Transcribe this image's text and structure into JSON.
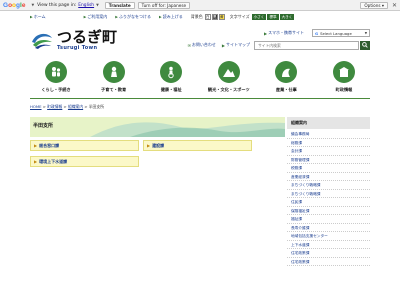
{
  "google_translate_bar": {
    "brand": "Google",
    "prompt": "View this page in:",
    "language": "English",
    "translate_label": "Translate",
    "turn_off_label": "Turn off for: Japanese",
    "options_label": "Options ▾",
    "close_label": "✕"
  },
  "top_nav": {
    "links": [
      "ホーム",
      "ご利用案内",
      "ふりがなをつける",
      "読み上げる"
    ],
    "color_label": "背景色",
    "swatch_labels": [
      "白",
      "黒",
      "黄"
    ],
    "font_label": "文字サイズ",
    "font_buttons": [
      "小さく",
      "標準",
      "大きく"
    ]
  },
  "logo": {
    "name_jp": "つるぎ町",
    "name_en": "Tsurugi Town"
  },
  "header": {
    "smartphone_link": "スマホ・携帯サイト",
    "contact_link": "お問い合わせ",
    "sitemap_link": "サイトマップ",
    "language_select": "Select Language",
    "search_placeholder": "サイト内検索"
  },
  "categories": [
    {
      "label": "くらし・手続き",
      "icon": "people-icon"
    },
    {
      "label": "子育て・教育",
      "icon": "child-icon"
    },
    {
      "label": "健康・福祉",
      "icon": "health-icon"
    },
    {
      "label": "観光・文化・スポーツ",
      "icon": "mountain-icon"
    },
    {
      "label": "産業・仕事",
      "icon": "industry-icon"
    },
    {
      "label": "町政情報",
      "icon": "government-icon"
    }
  ],
  "breadcrumb": {
    "items": [
      "HOME",
      "町政情報",
      "組織案内"
    ],
    "current": "半田支所"
  },
  "main": {
    "title": "半田支所",
    "departments": [
      "総合窓口課",
      "建設課",
      "環境上下水道課"
    ]
  },
  "sidebar": {
    "title": "組織案内",
    "items": [
      "議会事務局",
      "総務課",
      "会計課",
      "財務管理課",
      "税務課",
      "産業経済課",
      "まちづくり戦略課",
      "まちづくり戦略課",
      "住民課",
      "保険福祉課",
      "福祉課",
      "長寿介護課",
      "地域包括支援センター",
      "上下水道課",
      "住宅政策課",
      "住宅政策課"
    ]
  },
  "colors": {
    "accent_green": "#3f8a3f",
    "link_blue": "#1a3d8f",
    "banner_bg": "#e7f3c8",
    "button_bg": "#fbf8c8"
  }
}
